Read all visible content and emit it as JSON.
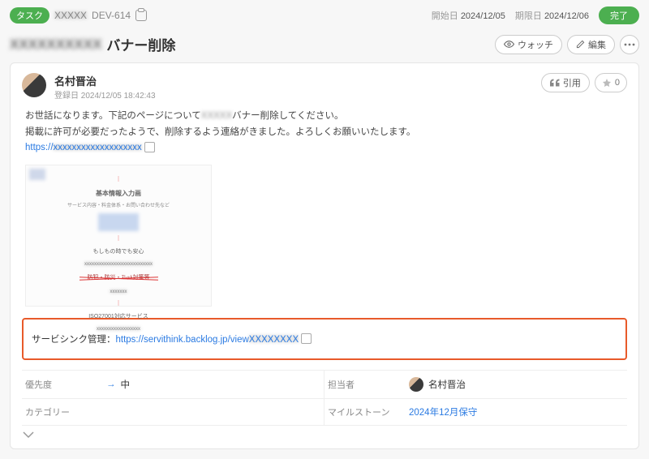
{
  "header": {
    "task_badge": "タスク",
    "task_key": "DEV-614",
    "start_label": "開始日",
    "start_date": "2024/12/05",
    "due_label": "期限日",
    "due_date": "2024/12/06",
    "status_badge": "完了"
  },
  "title": {
    "main": "バナー削除"
  },
  "actions": {
    "watch": "ウォッチ",
    "edit": "編集"
  },
  "comment": {
    "author": "名村晋治",
    "registered_label": "登録日",
    "registered_at": "2024/12/05 18:42:43",
    "quote_label": "引用",
    "star_count": "0",
    "line1_a": "お世話になります。下記のページについて",
    "line1_b": "バナー削除してください。",
    "line2": "掲載に許可が必要だったようで、削除するよう連絡がきました。よろしくお願いいたします。",
    "link_prefix": "https://"
  },
  "attachment": {
    "heading": "基本情報入力画",
    "tiny1": "サービス内容・料金体系・お問い合わせ先など",
    "sub1": "もしもの時でも安心",
    "strike": "防犯・防災・ｽﾚｯﾄ対策等",
    "sub2": "ISO27001対応サービス"
  },
  "highlight": {
    "label": "サービシンク管理：",
    "link": "https://servithink.backlog.jp/view"
  },
  "fields": {
    "priority_label": "優先度",
    "priority_value": "中",
    "assignee_label": "担当者",
    "assignee_value": "名村晋治",
    "category_label": "カテゴリー",
    "category_value": "",
    "milestone_label": "マイルストーン",
    "milestone_value": "2024年12月保守"
  }
}
